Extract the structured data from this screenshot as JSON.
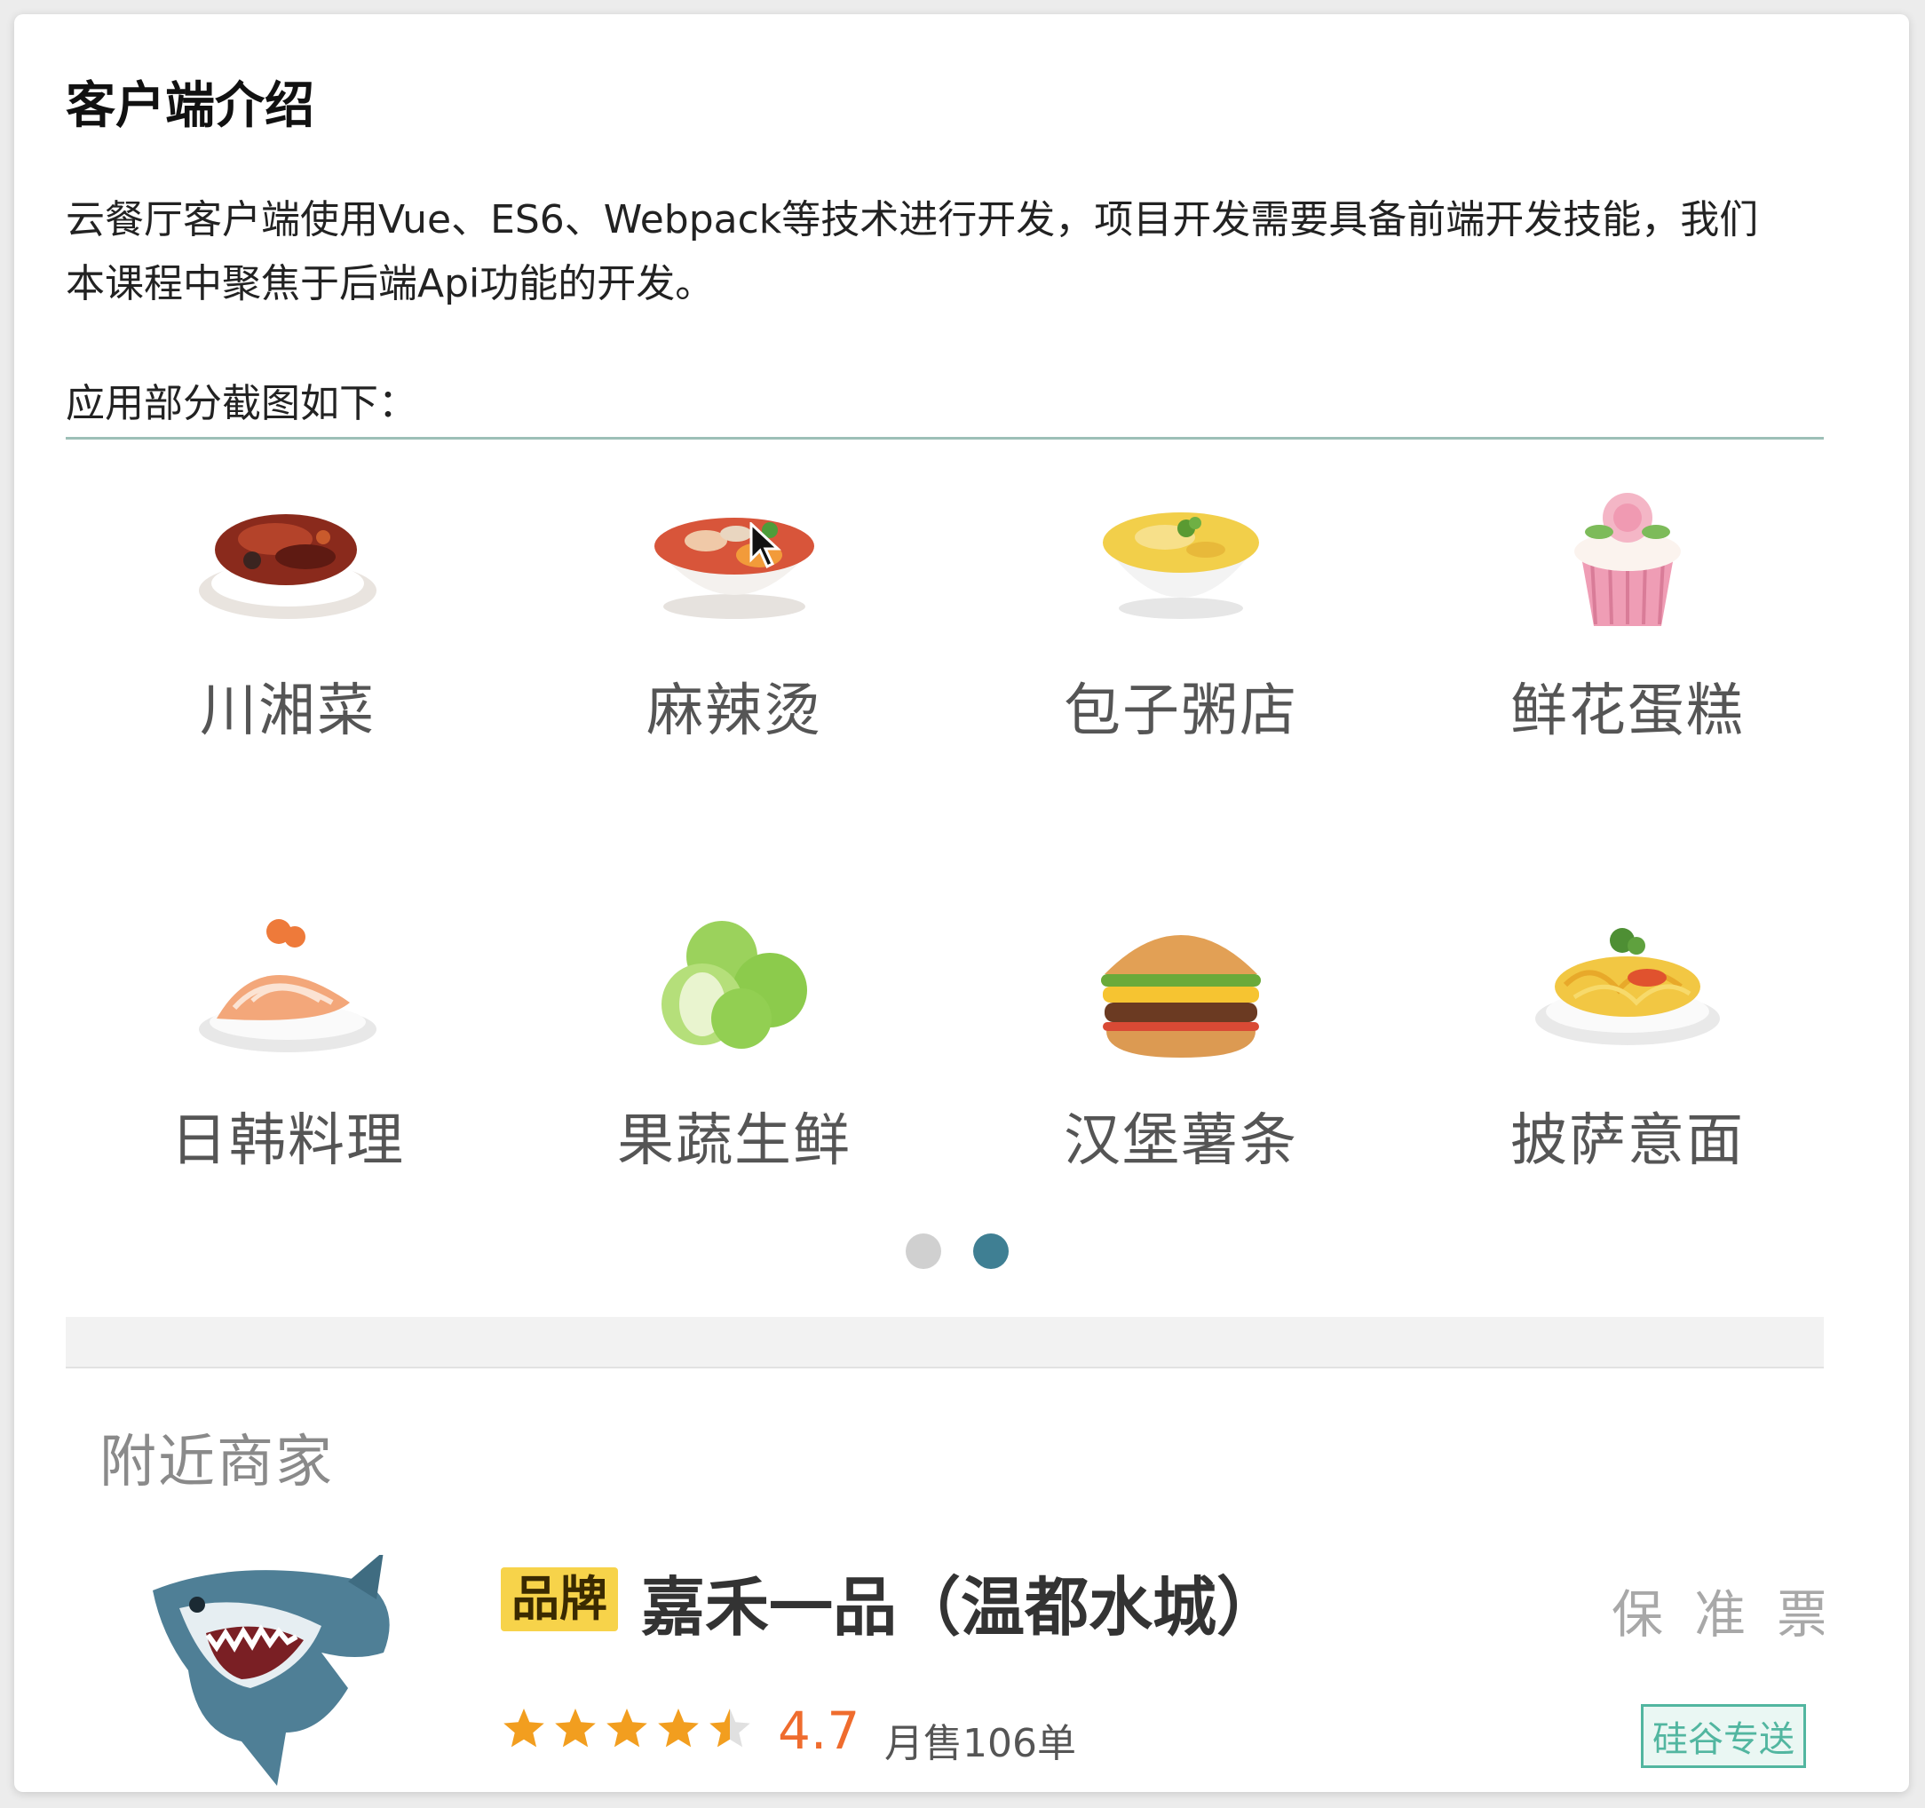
{
  "doc": {
    "title": "客户端介绍",
    "intro_line1": "云餐厅客户端使用Vue、ES6、Webpack等技术进行开发，项目开发需要具备前端开发技能，我们",
    "intro_line2": "本课程中聚焦于后端Api功能的开发。",
    "screenshots_label": "应用部分截图如下："
  },
  "categories": [
    {
      "label": "川湘菜",
      "icon": "spicy-dish-icon"
    },
    {
      "label": "麻辣烫",
      "icon": "malatang-bowl-icon"
    },
    {
      "label": "包子粥店",
      "icon": "porridge-bowl-icon"
    },
    {
      "label": "鲜花蛋糕",
      "icon": "flower-cake-icon"
    },
    {
      "label": "日韩料理",
      "icon": "sushi-icon"
    },
    {
      "label": "果蔬生鲜",
      "icon": "apple-icon"
    },
    {
      "label": "汉堡薯条",
      "icon": "burger-icon"
    },
    {
      "label": "披萨意面",
      "icon": "pasta-icon"
    }
  ],
  "carousel": {
    "pages": 2,
    "active_page": 2
  },
  "nearby": {
    "title": "附近商家",
    "shop": {
      "brand_tag": "品牌",
      "name": "嘉禾一品（温都水城）",
      "badges": [
        "保",
        "准",
        "票"
      ],
      "rating": 4.7,
      "rating_text": "4.7",
      "sales": "月售106单",
      "delivery": "硅谷专送",
      "logo_icon": "shark-logo-icon"
    }
  },
  "colors": {
    "accent": "#3f7f93",
    "brand_tag": "#f7d34a",
    "rating": "#ef6c2e",
    "delivery": "#52b6a0"
  }
}
